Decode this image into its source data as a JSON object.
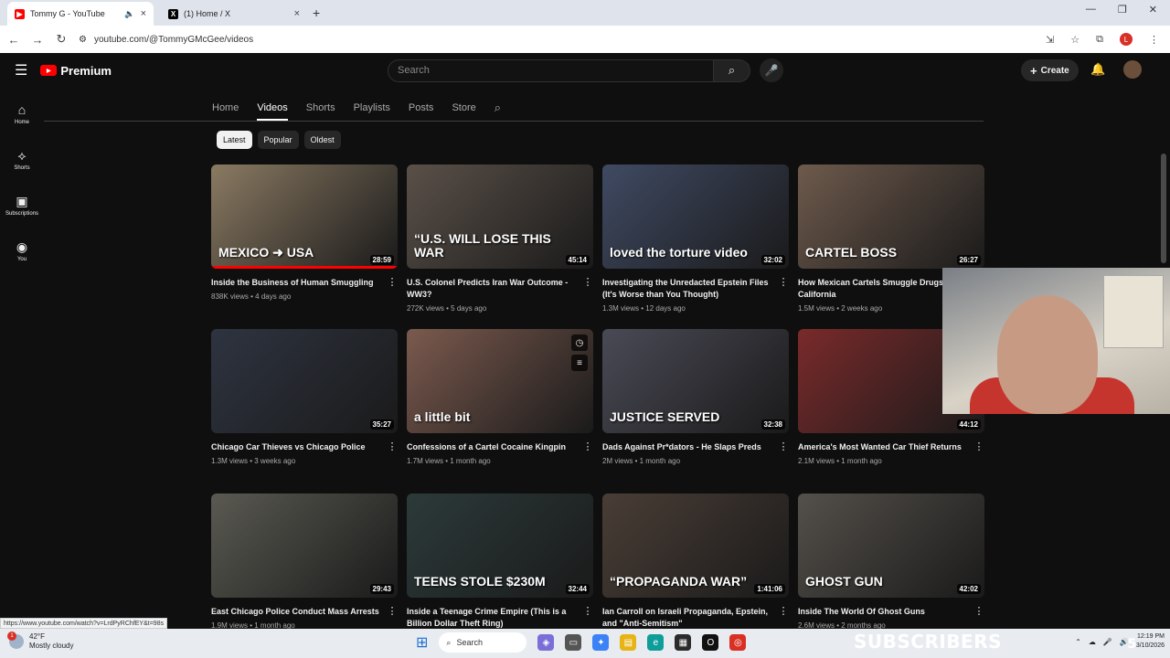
{
  "browser": {
    "tabs": [
      {
        "title": "Tommy G - YouTube",
        "active": true
      },
      {
        "title": "(1) Home / X",
        "active": false
      }
    ],
    "url": "youtube.com/@TommyGMcGee/videos",
    "profile_initial": "L"
  },
  "youtube": {
    "logo_text": "Premium",
    "search_placeholder": "Search",
    "create_label": "Create"
  },
  "sidebar": {
    "items": [
      {
        "label": "Home",
        "icon": "home-icon"
      },
      {
        "label": "Shorts",
        "icon": "shorts-icon"
      },
      {
        "label": "Subscriptions",
        "icon": "subscriptions-icon"
      },
      {
        "label": "You",
        "icon": "you-icon"
      }
    ]
  },
  "channel_tabs": [
    "Home",
    "Videos",
    "Shorts",
    "Playlists",
    "Posts",
    "Store"
  ],
  "chips": [
    "Latest",
    "Popular",
    "Oldest"
  ],
  "videos": [
    {
      "title": "Inside the Business of Human Smuggling",
      "meta": "838K views • 4 days ago",
      "duration": "28:59",
      "overlay": "MEXICO ➜ USA",
      "color": "#8a7a62",
      "progress": 1.0
    },
    {
      "title": "U.S. Colonel Predicts Iran War Outcome - WW3?",
      "meta": "272K views • 5 days ago",
      "duration": "45:14",
      "overlay": "“U.S. WILL LOSE THIS WAR",
      "color": "#5a5048",
      "progress": 0
    },
    {
      "title": "Investigating the Unredacted Epstein Files (It's Worse than You Thought)",
      "meta": "1.3M views • 12 days ago",
      "duration": "32:02",
      "overlay": "loved the torture video",
      "color": "#3f4a63",
      "progress": 0
    },
    {
      "title": "How Mexican Cartels Smuggle Drugs into California",
      "meta": "1.5M views • 2 weeks ago",
      "duration": "26:27",
      "overlay": "CARTEL BOSS",
      "color": "#6e5a4c",
      "progress": 0
    },
    {
      "title": "Chicago Car Thieves vs Chicago Police",
      "meta": "1.3M views • 3 weeks ago",
      "duration": "35:27",
      "overlay": "",
      "color": "#2e3440",
      "progress": 0
    },
    {
      "title": "Confessions of a Cartel Cocaine Kingpin",
      "meta": "1.7M views • 1 month ago",
      "duration": "",
      "overlay": "a little bit",
      "color": "#7b5a4e",
      "progress": 0
    },
    {
      "title": "Dads Against Pr*dators - He Slaps Preds",
      "meta": "2M views • 1 month ago",
      "duration": "32:38",
      "overlay": "JUSTICE SERVED",
      "color": "#4a4a56",
      "progress": 0
    },
    {
      "title": "America's Most Wanted Car Thief Returns",
      "meta": "2.1M views • 1 month ago",
      "duration": "44:12",
      "overlay": "",
      "color": "#7a2a2a",
      "progress": 0
    },
    {
      "title": "East Chicago Police Conduct Mass Arrests",
      "meta": "1.9M views • 1 month ago",
      "duration": "29:43",
      "overlay": "",
      "color": "#5a5a52",
      "progress": 0
    },
    {
      "title": "Inside a Teenage Crime Empire (This is a Billion Dollar Theft Ring)",
      "meta": "",
      "duration": "32:44",
      "overlay": "TEENS STOLE $230M",
      "color": "#2c3a3a",
      "progress": 0
    },
    {
      "title": "Ian Carroll on Israeli Propaganda, Epstein, and \"Anti-Semitism\"",
      "meta": "",
      "duration": "1:41:06",
      "overlay": "“PROPAGANDA WAR”",
      "color": "#4a3e36",
      "progress": 0
    },
    {
      "title": "Inside The World Of Ghost Guns",
      "meta": "2.6M views • 2 months ago",
      "duration": "42:02",
      "overlay": "GHOST GUN",
      "color": "#54504a",
      "progress": 0
    }
  ],
  "status_url": "https://www.youtube.com/watch?v=LrdPyRChfEY&t=98s",
  "overlay_banner": "SUBSCRIBERS",
  "overlay_count": "5",
  "taskbar": {
    "temperature": "42°F",
    "weather": "Mostly cloudy",
    "weather_badge": "1",
    "search_label": "Search",
    "time": "12:19 PM",
    "date": "3/10/2026"
  }
}
